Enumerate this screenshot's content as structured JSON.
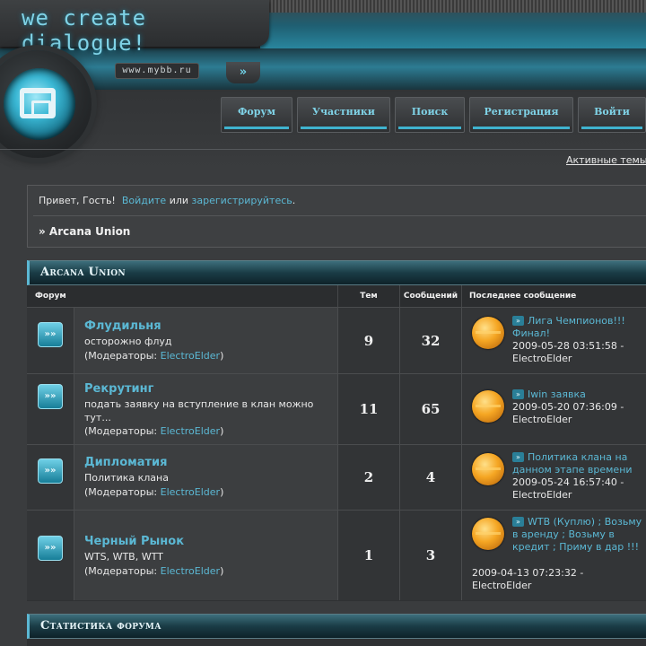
{
  "header": {
    "slogan": "we create dialogue!",
    "url_text": "www.mybb.ru",
    "url_arrow": "»",
    "nav": [
      {
        "label": "Форум"
      },
      {
        "label": "Участники"
      },
      {
        "label": "Поиск"
      },
      {
        "label": "Регистрация"
      },
      {
        "label": "Войти"
      }
    ],
    "active_topics": "Активные темы"
  },
  "greeting": {
    "prefix": "Привет, Гость!",
    "login_link": "Войдите",
    "or": "или",
    "register_link": "зарегистрируйтесь",
    "suffix": "."
  },
  "breadcrumb": "» Arcana Union",
  "forum_category": {
    "title": "Arcana Union",
    "columns": {
      "forum": "Форум",
      "topics": "Тем",
      "posts": "Сообщений",
      "last_post": "Последнее сообщение"
    },
    "forums": [
      {
        "name": "Флудильня",
        "description": "осторожно флуд",
        "mods_prefix": "(Модераторы:",
        "moderator": "ElectroElder",
        "mods_suffix": ")",
        "topics": "9",
        "posts": "32",
        "last_title": "Лига Чемпионов!!! Финал!",
        "last_date": "2009-05-28 03:51:58 -",
        "last_author": "ElectroElder"
      },
      {
        "name": "Рекрутинг",
        "description": "подать заявку на вступление в клан можно тут...",
        "mods_prefix": "(Модераторы:",
        "moderator": "ElectroElder",
        "mods_suffix": ")",
        "topics": "11",
        "posts": "65",
        "last_title": "Iwin заявка",
        "last_date": "2009-05-20 07:36:09 -",
        "last_author": "ElectroElder"
      },
      {
        "name": "Дипломатия",
        "description": "Политика клана",
        "mods_prefix": "(Модераторы:",
        "moderator": "ElectroElder",
        "mods_suffix": ")",
        "topics": "2",
        "posts": "4",
        "last_title": "Политика клана на данном этапе времени",
        "last_date": "2009-05-24 16:57:40 -",
        "last_author": "ElectroElder"
      },
      {
        "name": "Черный Рынок",
        "description": "WTS, WTB, WTT",
        "mods_prefix": "(Модераторы:",
        "moderator": "ElectroElder",
        "mods_suffix": ")",
        "topics": "1",
        "posts": "3",
        "last_title": "WTB (Куплю) ; Возьму в аренду ; Возьму в кредит ; Приму в дар !!!",
        "last_date": "2009-04-13 07:23:32 -",
        "last_author": "ElectroElder"
      }
    ]
  },
  "stats": {
    "title": "Статистика форума"
  }
}
